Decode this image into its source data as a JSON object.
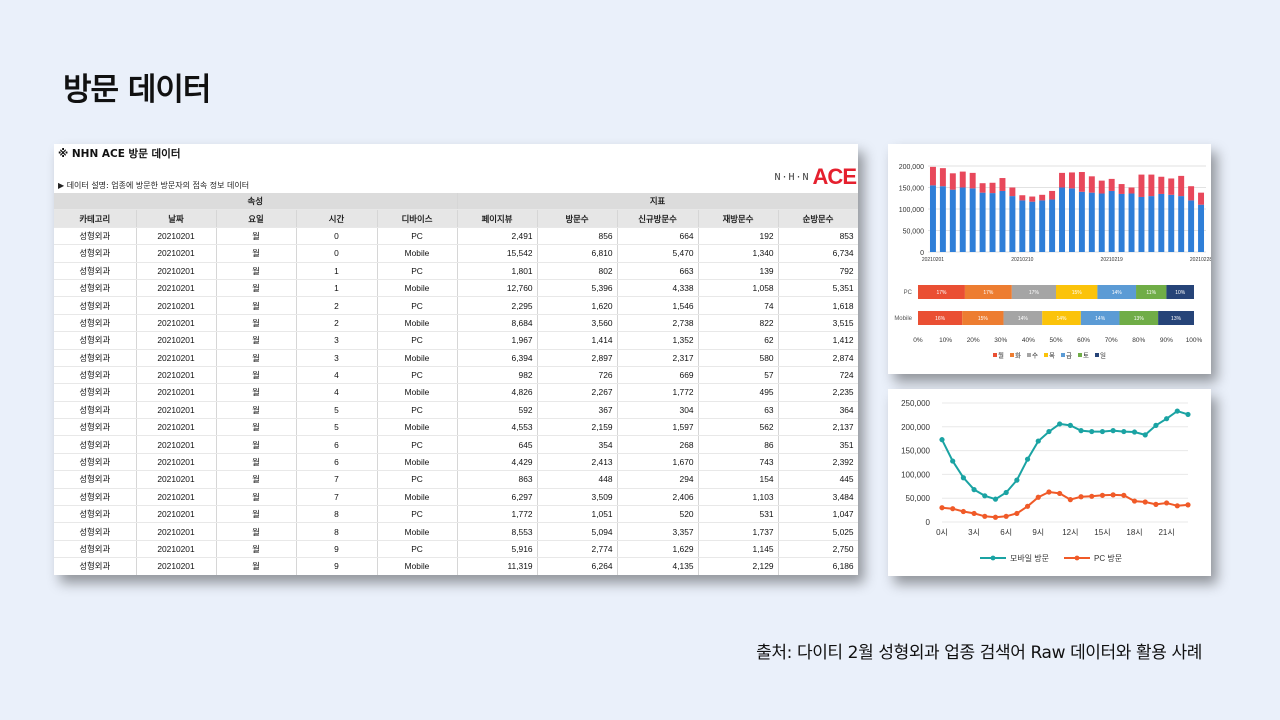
{
  "page": {
    "title": "방문 데이터",
    "source": "출처: 다이티 2월 성형외과 업종 검색어 Raw 데이터와 활용 사례"
  },
  "table_panel": {
    "title": "※ NHN ACE 방문 데이터",
    "description": "▶ 데이터 설명: 업종에 방문한 방문자의 접속 정보 데이터",
    "logo_nhn": "N·H·N",
    "logo_ace": "ACE",
    "group_headers": [
      "속성",
      "지표"
    ],
    "columns": [
      "카테고리",
      "날짜",
      "요일",
      "시간",
      "디바이스",
      "페이지뷰",
      "방문수",
      "신규방문수",
      "재방문수",
      "순방문수"
    ],
    "rows": [
      [
        "성형외과",
        "20210201",
        "월",
        "0",
        "PC",
        "2,491",
        "856",
        "664",
        "192",
        "853"
      ],
      [
        "성형외과",
        "20210201",
        "월",
        "0",
        "Mobile",
        "15,542",
        "6,810",
        "5,470",
        "1,340",
        "6,734"
      ],
      [
        "성형외과",
        "20210201",
        "월",
        "1",
        "PC",
        "1,801",
        "802",
        "663",
        "139",
        "792"
      ],
      [
        "성형외과",
        "20210201",
        "월",
        "1",
        "Mobile",
        "12,760",
        "5,396",
        "4,338",
        "1,058",
        "5,351"
      ],
      [
        "성형외과",
        "20210201",
        "월",
        "2",
        "PC",
        "2,295",
        "1,620",
        "1,546",
        "74",
        "1,618"
      ],
      [
        "성형외과",
        "20210201",
        "월",
        "2",
        "Mobile",
        "8,684",
        "3,560",
        "2,738",
        "822",
        "3,515"
      ],
      [
        "성형외과",
        "20210201",
        "월",
        "3",
        "PC",
        "1,967",
        "1,414",
        "1,352",
        "62",
        "1,412"
      ],
      [
        "성형외과",
        "20210201",
        "월",
        "3",
        "Mobile",
        "6,394",
        "2,897",
        "2,317",
        "580",
        "2,874"
      ],
      [
        "성형외과",
        "20210201",
        "월",
        "4",
        "PC",
        "982",
        "726",
        "669",
        "57",
        "724"
      ],
      [
        "성형외과",
        "20210201",
        "월",
        "4",
        "Mobile",
        "4,826",
        "2,267",
        "1,772",
        "495",
        "2,235"
      ],
      [
        "성형외과",
        "20210201",
        "월",
        "5",
        "PC",
        "592",
        "367",
        "304",
        "63",
        "364"
      ],
      [
        "성형외과",
        "20210201",
        "월",
        "5",
        "Mobile",
        "4,553",
        "2,159",
        "1,597",
        "562",
        "2,137"
      ],
      [
        "성형외과",
        "20210201",
        "월",
        "6",
        "PC",
        "645",
        "354",
        "268",
        "86",
        "351"
      ],
      [
        "성형외과",
        "20210201",
        "월",
        "6",
        "Mobile",
        "4,429",
        "2,413",
        "1,670",
        "743",
        "2,392"
      ],
      [
        "성형외과",
        "20210201",
        "월",
        "7",
        "PC",
        "863",
        "448",
        "294",
        "154",
        "445"
      ],
      [
        "성형외과",
        "20210201",
        "월",
        "7",
        "Mobile",
        "6,297",
        "3,509",
        "2,406",
        "1,103",
        "3,484"
      ],
      [
        "성형외과",
        "20210201",
        "월",
        "8",
        "PC",
        "1,772",
        "1,051",
        "520",
        "531",
        "1,047"
      ],
      [
        "성형외과",
        "20210201",
        "월",
        "8",
        "Mobile",
        "8,553",
        "5,094",
        "3,357",
        "1,737",
        "5,025"
      ],
      [
        "성형외과",
        "20210201",
        "월",
        "9",
        "PC",
        "5,916",
        "2,774",
        "1,629",
        "1,145",
        "2,750"
      ],
      [
        "성형외과",
        "20210201",
        "월",
        "9",
        "Mobile",
        "11,319",
        "6,264",
        "4,135",
        "2,129",
        "6,186"
      ]
    ]
  },
  "chart_data": [
    {
      "type": "bar",
      "stacked": true,
      "x_tick_labels": [
        "20210201",
        "20210210",
        "20210219",
        "20210228"
      ],
      "ylim": [
        0,
        200000
      ],
      "y_ticks": [
        "0",
        "50,000",
        "100,000",
        "150,000",
        "200,000"
      ],
      "grid": true,
      "series": [
        {
          "values": [
            155000,
            153000,
            145000,
            150000,
            148000,
            138000,
            137000,
            142000,
            130000,
            120000,
            117000,
            120000,
            122000,
            150000,
            148000,
            140000,
            138000,
            136000,
            142000,
            135000,
            136000,
            128000,
            130000,
            135000,
            133000,
            130000,
            120000,
            110000
          ],
          "color": "#2f7fd8"
        },
        {
          "values": [
            43000,
            42000,
            38000,
            37000,
            36000,
            22000,
            24000,
            30000,
            20000,
            12000,
            12000,
            13000,
            20000,
            34000,
            37000,
            46000,
            38000,
            30000,
            28000,
            23000,
            14000,
            52000,
            50000,
            40000,
            38000,
            47000,
            33000,
            28000
          ],
          "color": "#e8485b"
        }
      ]
    },
    {
      "type": "bar",
      "orientation": "horizontal",
      "stacked_percent": true,
      "categories": [
        "PC",
        "Mobile"
      ],
      "x_ticks": [
        "0%",
        "10%",
        "20%",
        "30%",
        "40%",
        "50%",
        "60%",
        "70%",
        "80%",
        "90%",
        "100%"
      ],
      "legend_position": "bottom",
      "series": [
        {
          "name": "월",
          "color": "#ea4f33",
          "values": [
            17,
            16
          ],
          "labels": [
            "17%",
            "16%"
          ]
        },
        {
          "name": "화",
          "color": "#ed7d31",
          "values": [
            17,
            15
          ],
          "labels": [
            "17%",
            "15%"
          ]
        },
        {
          "name": "수",
          "color": "#a5a5a5",
          "values": [
            16,
            14
          ],
          "labels": [
            "17%",
            "14%"
          ]
        },
        {
          "name": "목",
          "color": "#fbc30a",
          "values": [
            15,
            14
          ],
          "labels": [
            "15%",
            "14%"
          ]
        },
        {
          "name": "금",
          "color": "#5b9bd5",
          "values": [
            14,
            14
          ],
          "labels": [
            "14%",
            "14%"
          ]
        },
        {
          "name": "토",
          "color": "#70ad47",
          "values": [
            11,
            14
          ],
          "labels": [
            "11%",
            "13%"
          ]
        },
        {
          "name": "일",
          "color": "#264478",
          "values": [
            10,
            13
          ],
          "labels": [
            "10%",
            "13%"
          ]
        }
      ]
    },
    {
      "type": "line",
      "x": [
        0,
        1,
        2,
        3,
        4,
        5,
        6,
        7,
        8,
        9,
        10,
        11,
        12,
        13,
        14,
        15,
        16,
        17,
        18,
        19,
        20,
        21,
        22,
        23
      ],
      "x_tick_labels": [
        "0시",
        "3시",
        "6시",
        "9시",
        "12시",
        "15시",
        "18시",
        "21시"
      ],
      "ylim": [
        0,
        250000
      ],
      "y_ticks": [
        "0",
        "50,000",
        "100,000",
        "150,000",
        "200,000",
        "250,000"
      ],
      "legend_position": "bottom",
      "series": [
        {
          "name": "모바일 방문",
          "color": "#1aa3a3",
          "values": [
            173000,
            128000,
            93000,
            68000,
            55000,
            48000,
            62000,
            88000,
            132000,
            170000,
            190000,
            206000,
            203000,
            192000,
            190000,
            190000,
            192000,
            190000,
            189000,
            183000,
            203000,
            217000,
            233000,
            226000
          ]
        },
        {
          "name": "PC 방문",
          "color": "#f05a28",
          "values": [
            30000,
            28000,
            22000,
            18000,
            12000,
            10000,
            12000,
            18000,
            33000,
            52000,
            63000,
            60000,
            47000,
            53000,
            54000,
            56000,
            57000,
            56000,
            44000,
            42000,
            37000,
            40000,
            34000,
            36000
          ]
        }
      ]
    }
  ]
}
